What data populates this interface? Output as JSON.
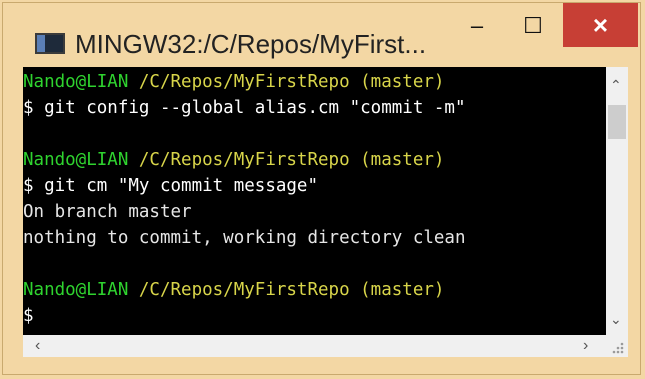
{
  "window": {
    "title": "MINGW32:/C/Repos/MyFirst...",
    "controls": {
      "minimize": "–",
      "maximize": "☐",
      "close": "×"
    }
  },
  "terminal": {
    "lines": [
      {
        "user": "Nando@LIAN",
        "path": " /C/Repos/MyFirstRepo (master)"
      },
      {
        "text": "$ git config --global alias.cm \"commit -m\""
      },
      {
        "text": ""
      },
      {
        "user": "Nando@LIAN",
        "path": " /C/Repos/MyFirstRepo (master)"
      },
      {
        "text": "$ git cm \"My commit message\""
      },
      {
        "text": "On branch master"
      },
      {
        "text": "nothing to commit, working directory clean"
      },
      {
        "text": ""
      },
      {
        "user": "Nando@LIAN",
        "path": " /C/Repos/MyFirstRepo (master)"
      },
      {
        "text": "$"
      }
    ]
  },
  "scrollbars": {
    "up": "⌃",
    "down": "⌄",
    "left": "‹",
    "right": "›"
  },
  "colors": {
    "user": "#2fd32f",
    "path": "#d8d54a",
    "close_bg": "#c73f35",
    "frame": "#f3d7a4"
  }
}
